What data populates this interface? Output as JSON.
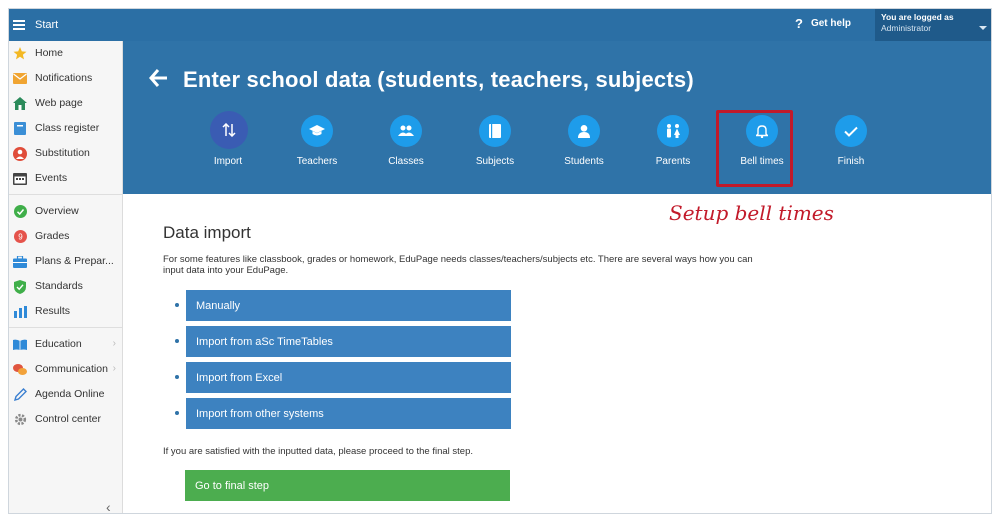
{
  "topbar": {
    "start_label": "Start",
    "help_label": "Get help",
    "help_icon": "?",
    "user_line1": "You are logged as",
    "user_line2": "Administrator"
  },
  "sidebar": {
    "items": [
      {
        "label": "Home",
        "icon": "star-icon"
      },
      {
        "label": "Notifications",
        "icon": "envelope-icon"
      },
      {
        "label": "Web page",
        "icon": "house-icon"
      },
      {
        "label": "Class register",
        "icon": "book-icon"
      },
      {
        "label": "Substitution",
        "icon": "person-swap-icon"
      },
      {
        "label": "Events",
        "icon": "calendar-icon"
      },
      {
        "label": "Overview",
        "icon": "check-circle-icon"
      },
      {
        "label": "Grades",
        "icon": "grades-icon"
      },
      {
        "label": "Plans & Prepar...",
        "icon": "briefcase-icon"
      },
      {
        "label": "Standards",
        "icon": "shield-check-icon"
      },
      {
        "label": "Results",
        "icon": "bar-chart-icon"
      },
      {
        "label": "Education",
        "icon": "open-book-icon"
      },
      {
        "label": "Communication",
        "icon": "chat-icon"
      },
      {
        "label": "Agenda Online",
        "icon": "pen-icon"
      },
      {
        "label": "Control center",
        "icon": "cog-icon"
      }
    ],
    "collapse_glyph": "‹"
  },
  "hero": {
    "title": "Enter school data (students, teachers, subjects)",
    "steps": [
      {
        "label": "Import",
        "icon": "import-arrows-icon",
        "active": true
      },
      {
        "label": "Teachers",
        "icon": "graduation-cap-icon"
      },
      {
        "label": "Classes",
        "icon": "group-icon"
      },
      {
        "label": "Subjects",
        "icon": "book-icon"
      },
      {
        "label": "Students",
        "icon": "person-icon"
      },
      {
        "label": "Parents",
        "icon": "parents-icon"
      },
      {
        "label": "Bell times",
        "icon": "bell-icon"
      },
      {
        "label": "Finish",
        "icon": "checkmark-icon"
      }
    ]
  },
  "annotation": "Setup bell times",
  "content": {
    "title": "Data import",
    "intro": "For some features like classbook, grades or homework, EduPage needs classes/teachers/subjects etc. There are several ways how you can input data into your EduPage.",
    "options": [
      "Manually",
      "Import from aSc TimeTables",
      "Import from Excel",
      "Import from other systems"
    ],
    "satisfied_text": "If you are satisfied with the inputted data, please proceed to the final step.",
    "final_button": "Go to final step"
  },
  "colors": {
    "brand": "#2f73a8",
    "option_button": "#3d82c0",
    "final_button": "#4cad4f",
    "annotation": "#c21a2a"
  }
}
